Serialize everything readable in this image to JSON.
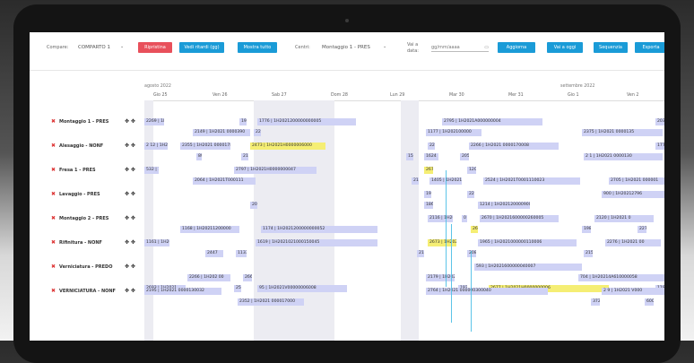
{
  "toolbar": {
    "compare_label": "Compare:",
    "compare_value": "COMPARTO 1",
    "ripristina": "Ripristina",
    "vedi_ritardi": "Vedi ritardi (gg)",
    "mostra_tutto": "Mostra tutto",
    "centri_label": "Centri:",
    "centri_value": "Montaggio 1 - PRES",
    "vai_label": "Vai a",
    "vai_label2": "data:",
    "date_placeholder": "gg/mm/aaaa",
    "aggiorna": "Aggiorna",
    "vai_oggi": "Vai a oggi",
    "sequenzia": "Sequenzia",
    "esporta": "Esporta"
  },
  "timeline": {
    "month1": "agosto 2022",
    "month2": "settembre 2022",
    "days": [
      "Gio 25",
      "Ven 26",
      "Sab 27",
      "Dom 28",
      "Lun 29",
      "Mar 30",
      "Mer 31",
      "Gio 1",
      "Ven 2"
    ]
  },
  "rows": [
    {
      "name": "Montaggio 1 - PRES",
      "bars": [
        "2269 | 1H2(",
        "198",
        "1776 | 1H2021200000000005",
        "",
        "2795 | 1H2021A000000004",
        "203",
        "2149 | 1H2021 0000390",
        "227",
        "1177 | 1H202100000",
        "2375 | 1H2021 0000135"
      ]
    },
    {
      "name": "Alesaggio - NONF",
      "bars": [
        "2 12 | 1H2",
        "2355 | 1H2021 0000178",
        "2473 | 1H2021H0000006000",
        "22",
        "2266 | 1H2021 0000170008",
        "1779",
        "89",
        "211",
        "155",
        "1624",
        "2051",
        "2 1 | 1H2021 0000130"
      ]
    },
    {
      "name": "Fresa 1 - PRES",
      "bars": [
        "532 | 1H20",
        "2797 | 1H2021H0000000047",
        "267",
        "1209",
        "2064 | 1H2021T000111",
        "211",
        "1405 | 1H20212",
        "2524 | 1H2021T0001110023",
        "2705 | 1H2021 000001"
      ]
    },
    {
      "name": "Lavaggio - PRES",
      "bars": [
        "193",
        "227",
        "900 | 1H20212796",
        "2069",
        "1869",
        "1214 | 1H20212000090011"
      ]
    },
    {
      "name": "Montaggio 2 - PRES",
      "bars": [
        "2116 | 1H2021",
        "0",
        "2670 | 1H2021600000260005",
        "2120 | 1H2021 0",
        "1168 | 1H20211200000",
        "1174 | 1H2021200000000052",
        "2676",
        "198",
        "227"
      ]
    },
    {
      "name": "Rifinitura - NONF",
      "bars": [
        "2276 | 1H2021",
        "1161 | 1H20",
        "1619 | 1H2021021000150045",
        "2673 | 1H2021",
        "1965 | 1H2021000000110006",
        "2276 | 1H2021 00",
        "2447",
        "1133 | 16",
        "211",
        "2085",
        "2155"
      ]
    },
    {
      "name": "Verniciatura - PREDO",
      "bars": [
        "593 | 1H2021600000040007",
        "2266 | 1H202 00",
        "2665",
        "2179 | 1H2021 0",
        "704 | 1H20214A610000058",
        "2693 | 1H2021",
        "2563",
        "95 | 1H2021V00000006008",
        "1929",
        "2677 | 1H2021H0000000006",
        "1183"
      ]
    },
    {
      "name": "VERNICIATURA - NONF",
      "bars": [
        "2195 | 1H2021 0000130032",
        "2764 | 1H2021 000000300040",
        "2 9 | 1H2021 V000",
        "2352 | 1H2021 000017000",
        "372",
        "600"
      ]
    },
    {
      "name": "",
      "bars": []
    }
  ]
}
